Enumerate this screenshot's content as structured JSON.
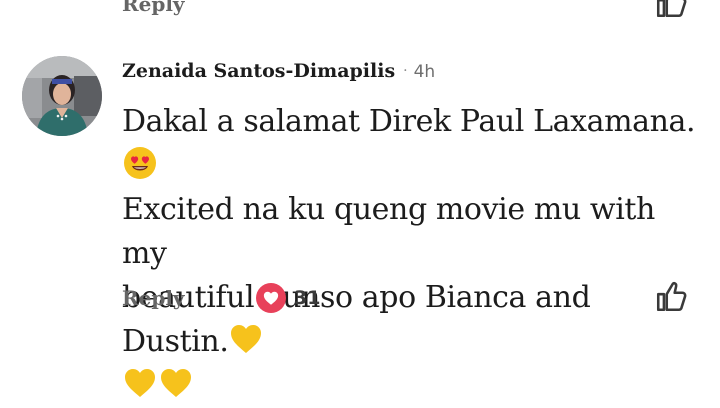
{
  "previous_comment": {
    "reply_label": "Reply"
  },
  "comment": {
    "author": "Zenaida Santos-Dimapilis",
    "separator": "·",
    "time": "4h",
    "text": {
      "line1": "Dakal a salamat Direk Paul Laxamana.",
      "line2": "Excited na ku queng movie mu with my",
      "line3": "beautiful bunso apo Bianca and Dustin."
    },
    "emojis": [
      "heart-eyes-emoji",
      "yellow-heart-emoji",
      "yellow-heart-emoji",
      "yellow-heart-emoji"
    ],
    "reply_label": "Reply",
    "reaction_count": "31",
    "reaction_type": "love-reaction-icon"
  },
  "colors": {
    "reaction_red": "#e8415a",
    "emoji_yellow": "#f6c21c",
    "muted_text": "#656565"
  }
}
